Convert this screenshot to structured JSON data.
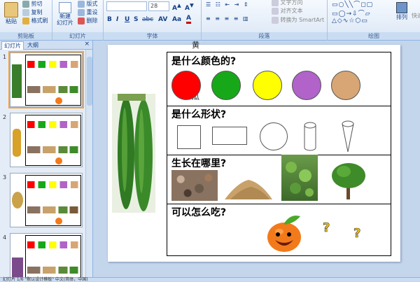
{
  "ribbon": {
    "clipboard": {
      "paste": "粘贴",
      "cut": "剪切",
      "copy": "复制",
      "format_painter": "格式刷",
      "label": "剪贴板"
    },
    "slides": {
      "new_slide": "新建\n幻灯片",
      "layout": "版式",
      "reset": "重设",
      "delete": "删除",
      "label": "幻灯片"
    },
    "font": {
      "size": "28",
      "label": "字体",
      "buttons": [
        "B",
        "I",
        "U",
        "S",
        "abc",
        "AV",
        "Aa",
        "A"
      ]
    },
    "paragraph": {
      "text_direction": "文字方向",
      "align_text": "对齐文本",
      "smartart": "转换为 SmartArt",
      "label": "段落"
    },
    "drawing": {
      "arrange": "排列",
      "quick_styles": "快速",
      "label": "绘图"
    }
  },
  "panel": {
    "tabs": [
      "幻灯片",
      "大纲"
    ],
    "close": "×",
    "slide_numbers": [
      "1",
      "2",
      "3",
      "4"
    ]
  },
  "slide": {
    "questions": [
      "是什么颜色的?",
      "是什么形状?",
      "生长在哪里?",
      "可以怎么吃?"
    ],
    "colors": [
      "#ff0000",
      "#17a81a",
      "#ffff00",
      "#b163c9",
      "#d8a674"
    ],
    "vertical_chars": [
      "黄",
      "瓜"
    ]
  },
  "status": {
    "text": "幻灯片 1/6   \"默认设计模板\"   中文(简体，中国)"
  }
}
